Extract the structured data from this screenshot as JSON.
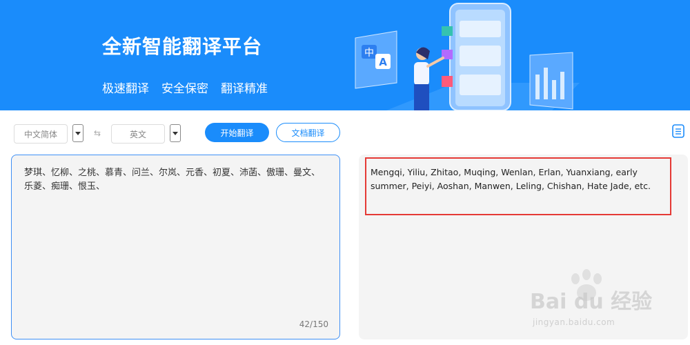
{
  "banner": {
    "title": "全新智能翻译平台",
    "features": [
      "极速翻译",
      "安全保密",
      "翻译精准"
    ],
    "illustration_glyphs": {
      "zh": "中",
      "en": "A"
    }
  },
  "toolbar": {
    "source_language": "中文简体",
    "target_language": "英文",
    "swap_icon": "⇆",
    "translate_button": "开始翻译",
    "document_button": "文档翻译"
  },
  "source": {
    "text": "梦琪、忆柳、之桃、慕青、问兰、尔岚、元香、初夏、沛菡、傲珊、曼文、乐菱、痴珊、恨玉、",
    "counter": "42/150"
  },
  "target": {
    "text": "Mengqi, Yiliu, Zhitao, Muqing, Wenlan, Erlan, Yuanxiang, early summer, Peiyi, Aoshan, Manwen, Leling, Chishan, Hate Jade, etc."
  },
  "watermark": {
    "text": "Bai du 经验",
    "url": "jingyan.baidu.com"
  },
  "colors": {
    "brand": "#1a8cfb",
    "highlight": "#e53935",
    "panel": "#f4f4f4"
  }
}
